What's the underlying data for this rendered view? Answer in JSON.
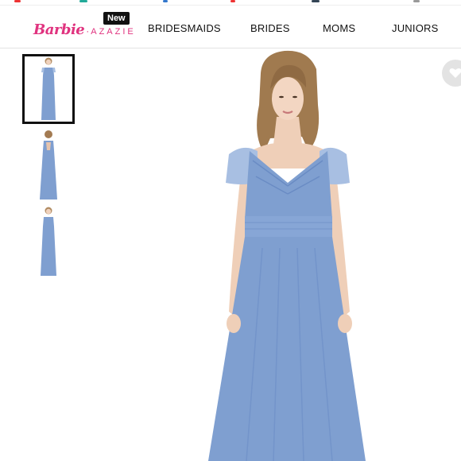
{
  "header": {
    "logo_barbie": "Barbie",
    "logo_separator": "·",
    "logo_azazie": "AZAZIE",
    "new_badge": "New",
    "nav": [
      "BRIDESMAIDS",
      "BRIDES",
      "MOMS",
      "JUNIORS"
    ]
  },
  "gallery": {
    "thumbnails": [
      "front view",
      "back view",
      "side view"
    ],
    "selected_index": 0
  },
  "product": {
    "dress_color": "#7f9fd0",
    "wishlist_icon": "heart-icon"
  },
  "colors": {
    "brand_pink": "#e0337f",
    "badge_bg": "#111111",
    "thumb_border": "#111111"
  }
}
